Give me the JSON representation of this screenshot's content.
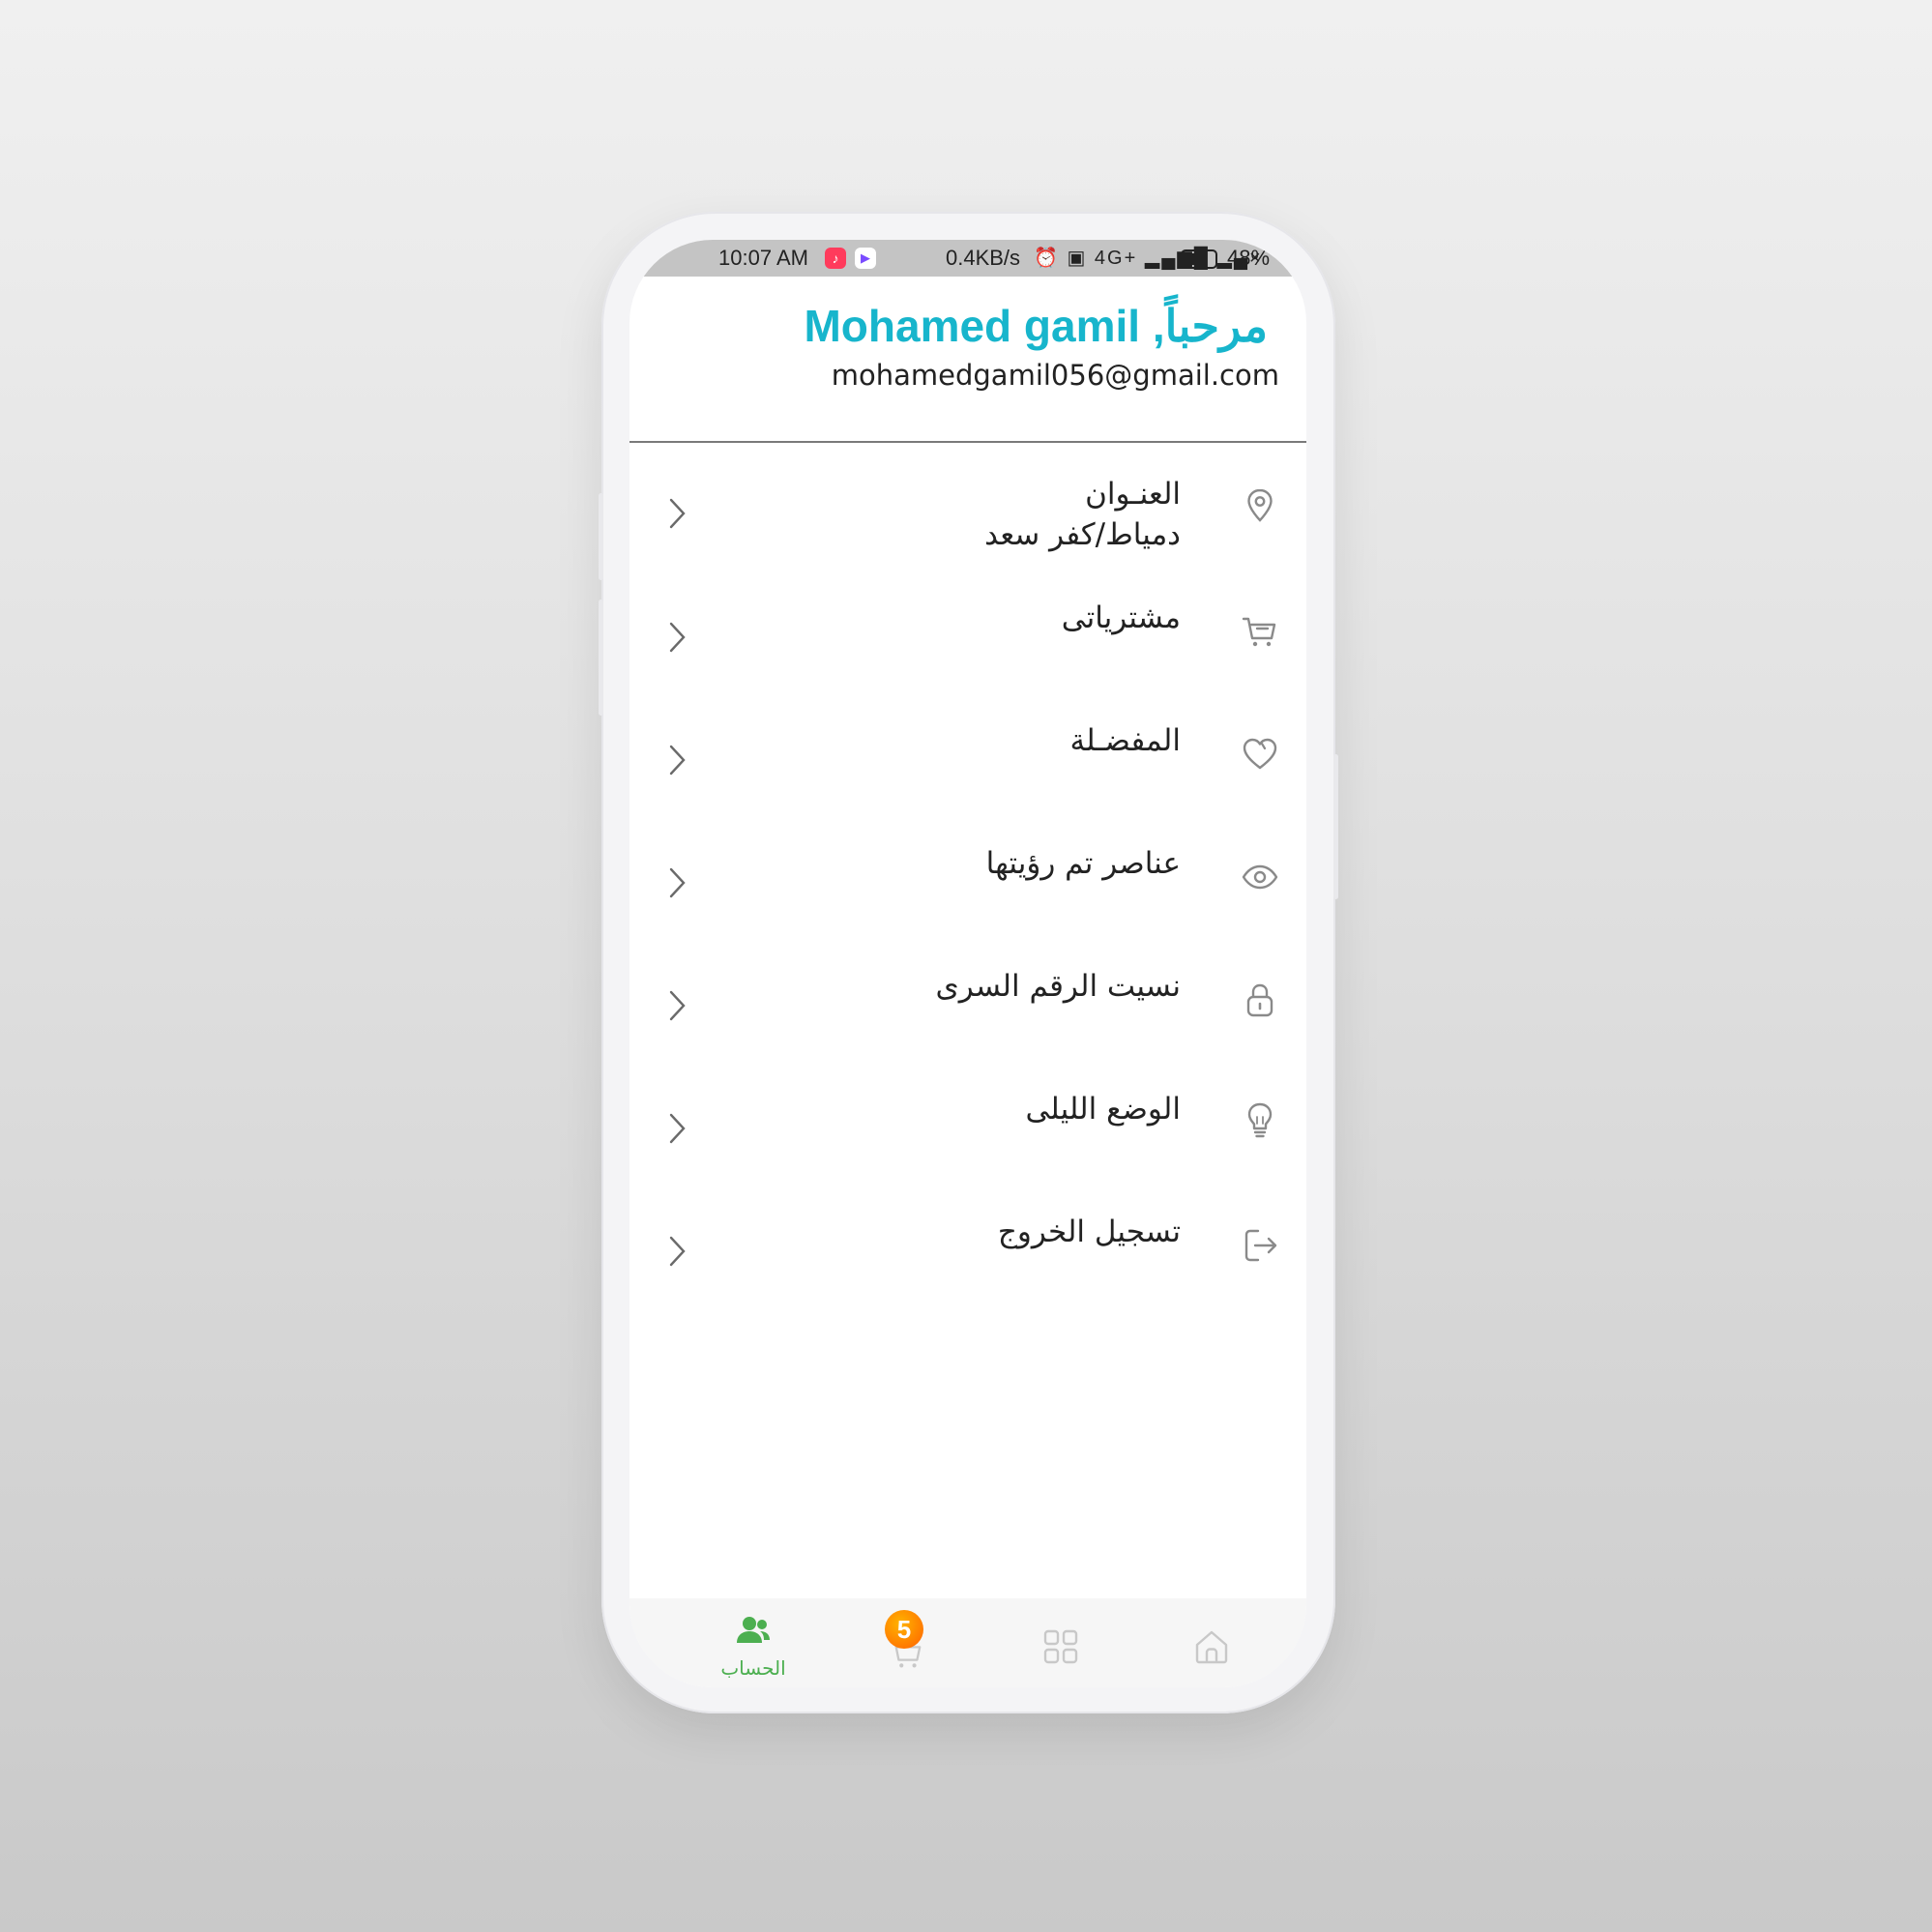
{
  "status_bar": {
    "time": "10:07 AM",
    "speed": "0.4KB/s",
    "indicators": "⏰ ▣ 4G+ ▂▄▆█ ▂▄×",
    "battery": "48%"
  },
  "header": {
    "greeting": "مرحباً, Mohamed gamil",
    "email": "mohamedgamil056@gmail.com"
  },
  "menu": [
    {
      "label": "العنـوان",
      "sub": "دمياط/كفر سعد",
      "icon": "location-pin-icon"
    },
    {
      "label": "مشترياتى",
      "icon": "cart-icon"
    },
    {
      "label": "المفضـلة",
      "icon": "heart-icon"
    },
    {
      "label": "عناصر تم رؤيتها",
      "icon": "eye-icon"
    },
    {
      "label": "نسيت الرقم السرى",
      "icon": "lock-icon"
    },
    {
      "label": "الوضع الليلى",
      "icon": "lightbulb-icon"
    },
    {
      "label": "تسجيل الخروج",
      "icon": "logout-icon"
    }
  ],
  "bottom_nav": {
    "account_label": "الحساب",
    "cart_badge": "5",
    "active_color": "#4caf50"
  },
  "colors": {
    "accent": "#17b5cc",
    "icon_gray": "#8a8a8a"
  }
}
